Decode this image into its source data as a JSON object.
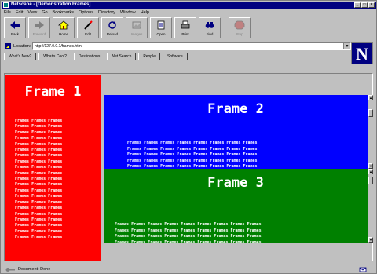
{
  "window": {
    "title": "Netscape - [Demonstration Frames]"
  },
  "menu": [
    "File",
    "Edit",
    "View",
    "Go",
    "Bookmarks",
    "Options",
    "Directory",
    "Window",
    "Help"
  ],
  "toolbar": [
    {
      "label": "Back",
      "icon": "back-arrow-icon",
      "enabled": true
    },
    {
      "label": "Forward",
      "icon": "forward-arrow-icon",
      "enabled": false
    },
    {
      "label": "Home",
      "icon": "home-icon",
      "enabled": true
    },
    {
      "label": "Edit",
      "icon": "edit-pencil-icon",
      "enabled": true
    },
    {
      "label": "Reload",
      "icon": "reload-icon",
      "enabled": true
    },
    {
      "label": "Images",
      "icon": "images-icon",
      "enabled": false
    },
    {
      "label": "Open",
      "icon": "open-icon",
      "enabled": true
    },
    {
      "label": "Print",
      "icon": "print-icon",
      "enabled": true
    },
    {
      "label": "Find",
      "icon": "find-binoculars-icon",
      "enabled": true
    },
    {
      "label": "Stop",
      "icon": "stop-icon",
      "enabled": false
    }
  ],
  "location": {
    "label": "Location:",
    "value": "http://127.0.0.1/frames.htm"
  },
  "directory_buttons": [
    "What's New?",
    "What's Cool?",
    "Destinations",
    "Net Search",
    "People",
    "Software"
  ],
  "brand": {
    "logo_letter": "N"
  },
  "frames": [
    {
      "title": "Frame 1",
      "filler": "Frames Frames Frames",
      "lines": 21,
      "color": "#ff0000"
    },
    {
      "title": "Frame 2",
      "filler": "Frames Frames Frames Frames Frames Frames Frames Frames",
      "lines": 5,
      "color": "#0000ff"
    },
    {
      "title": "Frame 3",
      "filler": "Frames Frames Frames Frames Frames Frames Frames Frames Frames",
      "lines": 4,
      "color": "#008000"
    }
  ],
  "status": {
    "text": "Document: Done"
  }
}
